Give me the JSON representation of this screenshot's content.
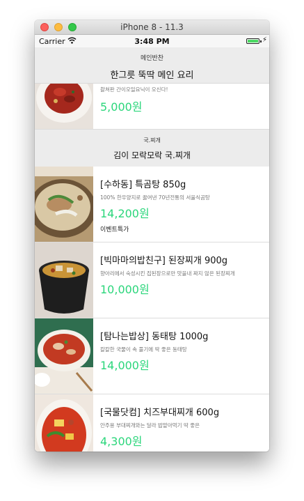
{
  "window": {
    "title": "iPhone 8 - 11.3"
  },
  "status": {
    "carrier": "Carrier",
    "time": "3:48 PM"
  },
  "nav": {
    "small": "메인반찬",
    "title": "한그릇 뚝딱 메인 요리"
  },
  "top_item": {
    "desc": "촬쳐판 간이오일요닉이 오신다!",
    "price": "5,000원"
  },
  "section": {
    "small": "국.찌개",
    "title": "김이 모락모락 국.찌개"
  },
  "items": [
    {
      "name": "[수하동] 특곰탕 850g",
      "desc": "100% 한우양지로 끓여낸 70년전통의 서울식곰탕",
      "price": "14,200원",
      "badge": "이벤트특가"
    },
    {
      "name": "[빅마마의밥친구] 된장찌개 900g",
      "desc": "향아리에서 숙성시킨 집된장으로만 맛을내 짜지 않은 된장찌개",
      "price": "10,000원"
    },
    {
      "name": "[탐나는밥상] 동태탕 1000g",
      "desc": "칼칼한 국물이 속 풀기에 딱 좋은 동태탕",
      "price": "14,000원"
    },
    {
      "name": "[국물닷컴] 치즈부대찌개 600g",
      "desc": "안주용 부대찌개와는 달라 밥맡아먹기 딱 좋은",
      "price": "4,300원"
    }
  ],
  "icons": [
    "wifi-icon",
    "battery-icon",
    "charging-bolt-icon"
  ],
  "colors": {
    "price": "#2bd67b",
    "header_bg": "#ececec"
  }
}
